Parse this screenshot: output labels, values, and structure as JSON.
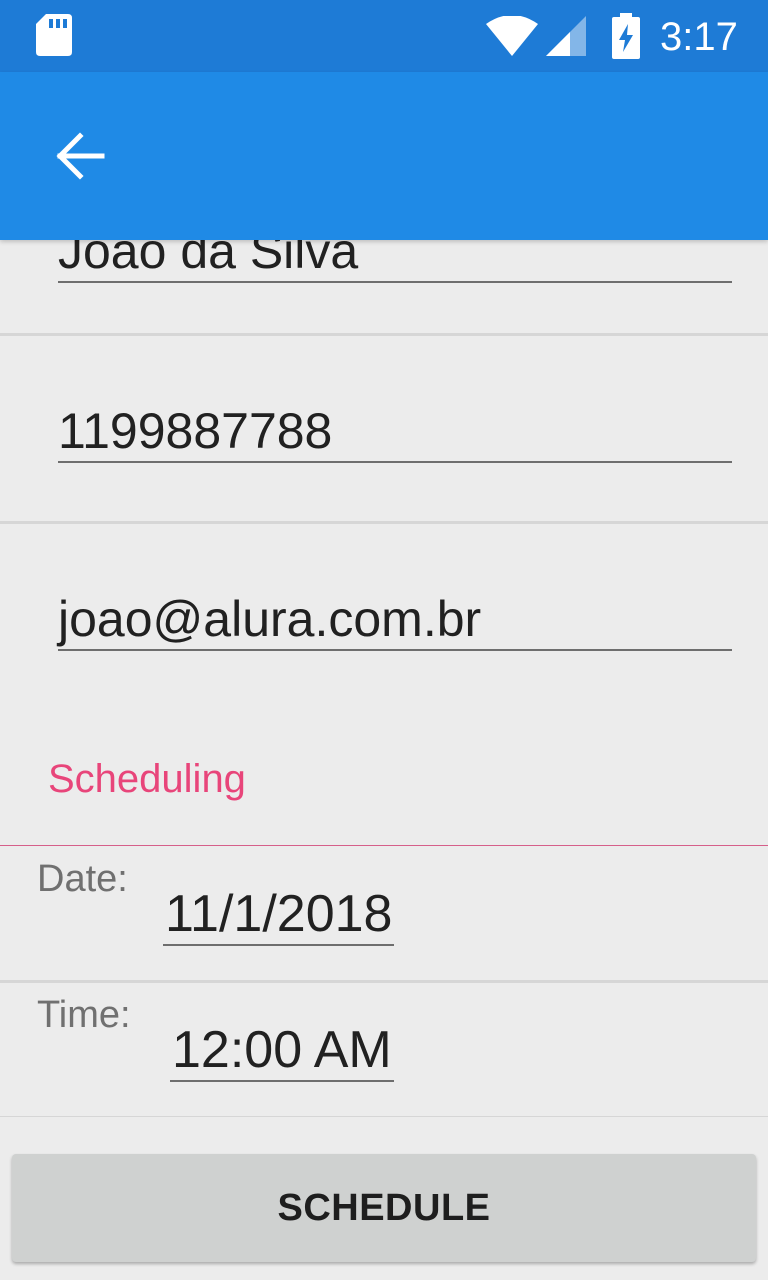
{
  "status_bar": {
    "time": "3:17",
    "icons": [
      "sd-card-icon",
      "wifi-icon",
      "cell-signal-icon",
      "battery-charging-icon"
    ],
    "background_color": "#1e7bd6"
  },
  "toolbar": {
    "back_icon": "arrow-back-icon",
    "background_color": "#1f8ae6"
  },
  "form": {
    "name_value": "Joao da Silva",
    "phone_value": "1199887788",
    "email_value": "joao@alura.com.br"
  },
  "scheduling": {
    "section_title": "Scheduling",
    "accent_color": "#e8457a",
    "date_label": "Date:",
    "date_value": "11/1/2018",
    "time_label": "Time:",
    "time_value": "12:00 AM"
  },
  "schedule_button": {
    "label": "SCHEDULE"
  }
}
